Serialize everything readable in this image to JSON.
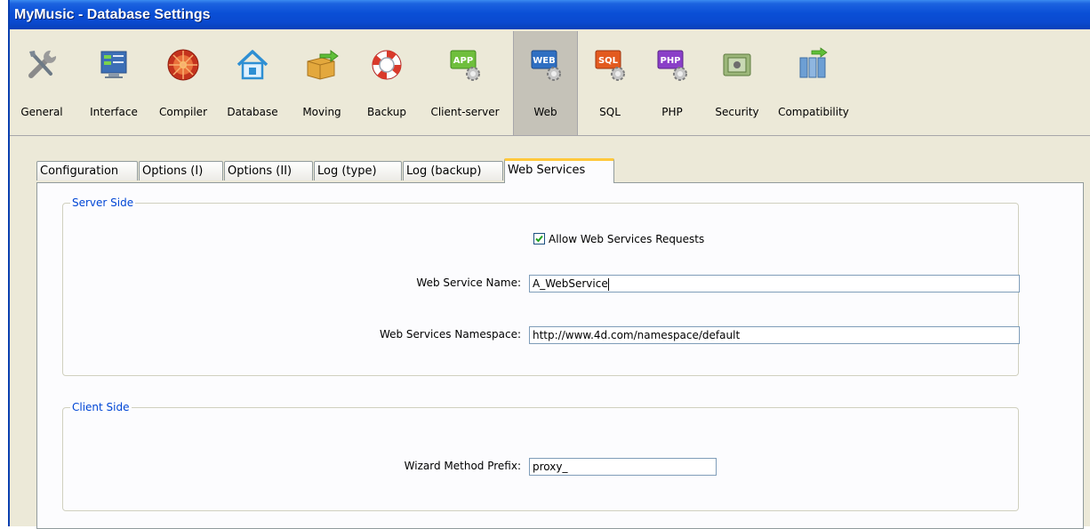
{
  "window": {
    "title": "MyMusic - Database Settings"
  },
  "toolbar": {
    "items": [
      {
        "label": "General",
        "icon": "tools-icon"
      },
      {
        "label": "Interface",
        "icon": "interface-icon"
      },
      {
        "label": "Compiler",
        "icon": "compiler-icon"
      },
      {
        "label": "Database",
        "icon": "database-icon"
      },
      {
        "label": "Moving",
        "icon": "moving-icon"
      },
      {
        "label": "Backup",
        "icon": "backup-icon"
      },
      {
        "label": "Client-server",
        "icon": "client-server-icon"
      },
      {
        "label": "Web",
        "icon": "web-icon",
        "active": true
      },
      {
        "label": "SQL",
        "icon": "sql-icon"
      },
      {
        "label": "PHP",
        "icon": "php-icon"
      },
      {
        "label": "Security",
        "icon": "security-icon"
      },
      {
        "label": "Compatibility",
        "icon": "compatibility-icon"
      }
    ]
  },
  "tabs": [
    {
      "label": "Configuration"
    },
    {
      "label": "Options (I)"
    },
    {
      "label": "Options (II)"
    },
    {
      "label": "Log (type)"
    },
    {
      "label": "Log (backup)"
    },
    {
      "label": "Web Services",
      "active": true
    }
  ],
  "server_side": {
    "legend": "Server Side",
    "allow_requests": {
      "label": "Allow Web Services Requests",
      "checked": true
    },
    "service_name": {
      "label": "Web Service Name:",
      "value": "A_WebService"
    },
    "namespace": {
      "label": "Web Services Namespace:",
      "value": "http://www.4d.com/namespace/default"
    }
  },
  "client_side": {
    "legend": "Client Side",
    "prefix": {
      "label": "Wizard Method Prefix:",
      "value": "proxy_"
    }
  },
  "colors": {
    "accent": "#0046d5",
    "active_tab": "#ffc83c",
    "titlebar": "#0a4fd6"
  }
}
